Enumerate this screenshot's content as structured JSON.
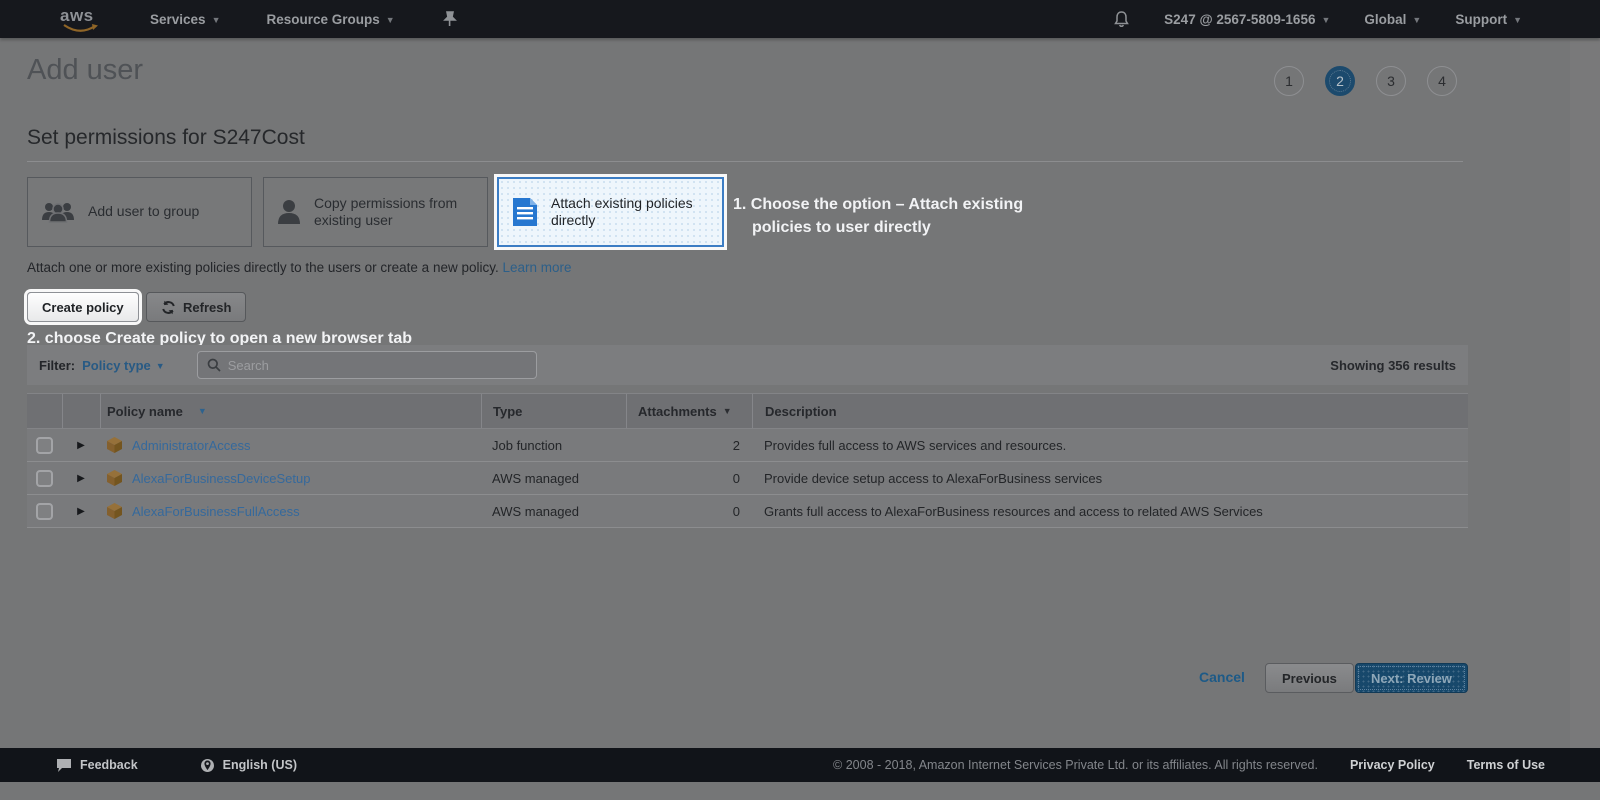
{
  "colors": {
    "accent_blue": "#3c7dc4",
    "aws_orange": "#9a6a30",
    "link_blue": "#2c5f89",
    "highlight_bg": "#eef6fc",
    "topbar_bg": "#16181d"
  },
  "topbar": {
    "logo_text": "aws",
    "services": "Services",
    "resource_groups": "Resource Groups",
    "account": "S247 @ 2567-5809-1656",
    "region": "Global",
    "support": "Support"
  },
  "page": {
    "title": "Add user",
    "steps": [
      "1",
      "2",
      "3",
      "4"
    ],
    "active_step": "2",
    "heading": "Set permissions for S247Cost"
  },
  "options": {
    "group": {
      "label": "Add user to group"
    },
    "copy": {
      "label": "Copy permissions from existing user"
    },
    "attach": {
      "label": "Attach existing policies directly"
    }
  },
  "annotations": {
    "one": "1. Choose the option – Attach existing policies to user directly",
    "two": "2. choose Create policy to open a new browser tab"
  },
  "intro": {
    "text": "Attach one or more existing policies directly to the users or create a new policy.",
    "link": "Learn more"
  },
  "toolbar": {
    "create_policy": "Create policy",
    "refresh": "Refresh"
  },
  "filter": {
    "label": "Filter:",
    "selected": "Policy type",
    "search_placeholder": "Search",
    "results": "Showing 356 results"
  },
  "table": {
    "columns": {
      "name": "Policy name",
      "type": "Type",
      "attachments": "Attachments",
      "description": "Description"
    },
    "rows": [
      {
        "name": "AdministratorAccess",
        "type": "Job function",
        "attachments": "2",
        "description": "Provides full access to AWS services and resources."
      },
      {
        "name": "AlexaForBusinessDeviceSetup",
        "type": "AWS managed",
        "attachments": "0",
        "description": "Provide device setup access to AlexaForBusiness services"
      },
      {
        "name": "AlexaForBusinessFullAccess",
        "type": "AWS managed",
        "attachments": "0",
        "description": "Grants full access to AlexaForBusiness resources and access to related AWS Services"
      }
    ]
  },
  "actions": {
    "cancel": "Cancel",
    "previous": "Previous",
    "next": "Next: Review"
  },
  "footer": {
    "feedback": "Feedback",
    "language": "English (US)",
    "copyright": "© 2008 - 2018, Amazon Internet Services Private Ltd. or its affiliates. All rights reserved.",
    "privacy": "Privacy Policy",
    "terms": "Terms of Use"
  }
}
